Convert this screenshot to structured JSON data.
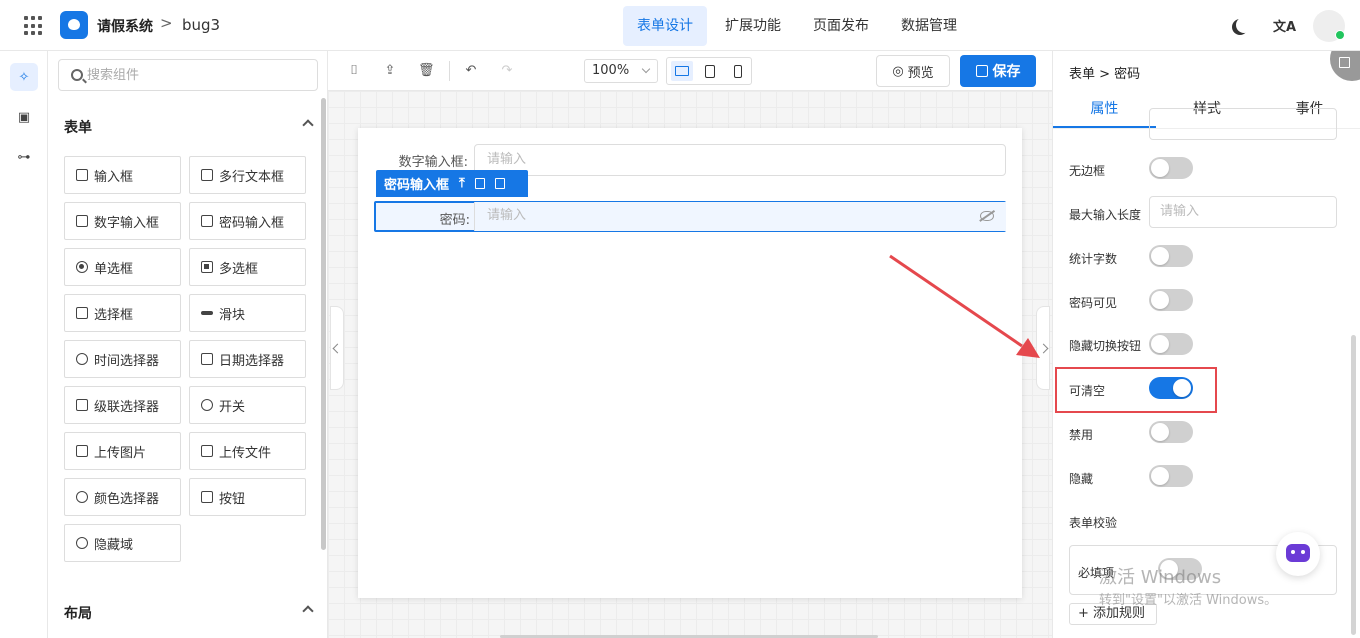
{
  "header": {
    "app_name": "请假系统",
    "crumb_separator": ">",
    "current_app": "bug3",
    "tabs": [
      {
        "label": "表单设计",
        "active": true
      },
      {
        "label": "扩展功能",
        "active": false
      },
      {
        "label": "页面发布",
        "active": false
      },
      {
        "label": "数据管理",
        "active": false
      }
    ],
    "icons": [
      "apps-grid-icon",
      "moon-icon",
      "translate-icon",
      "avatar"
    ]
  },
  "component_panel": {
    "search_placeholder": "搜索组件",
    "section_form": "表单",
    "components": [
      {
        "label": "输入框",
        "icon": "edit-icon"
      },
      {
        "label": "多行文本框",
        "icon": "textarea-icon"
      },
      {
        "label": "数字输入框",
        "icon": "number-icon"
      },
      {
        "label": "密码输入框",
        "icon": "lock-icon"
      },
      {
        "label": "单选框",
        "icon": "radio-icon"
      },
      {
        "label": "多选框",
        "icon": "checkbox-icon"
      },
      {
        "label": "选择框",
        "icon": "select-icon"
      },
      {
        "label": "滑块",
        "icon": "slider-icon"
      },
      {
        "label": "时间选择器",
        "icon": "clock-icon"
      },
      {
        "label": "日期选择器",
        "icon": "calendar-icon"
      },
      {
        "label": "级联选择器",
        "icon": "cascader-icon"
      },
      {
        "label": "开关",
        "icon": "switch-icon"
      },
      {
        "label": "上传图片",
        "icon": "image-icon"
      },
      {
        "label": "上传文件",
        "icon": "upload-icon"
      },
      {
        "label": "颜色选择器",
        "icon": "palette-icon"
      },
      {
        "label": "按钮",
        "icon": "button-icon"
      },
      {
        "label": "隐藏域",
        "icon": "eye-off-icon"
      }
    ],
    "section_layout": "布局"
  },
  "toolbar": {
    "zoom": "100%",
    "preview_label": "预览",
    "save_label": "保存"
  },
  "canvas": {
    "fields": [
      {
        "label": "数字输入框:",
        "placeholder": "请输入"
      },
      {
        "label": "密码:",
        "placeholder": "请输入"
      }
    ],
    "selected_component_label": "密码输入框"
  },
  "props_panel": {
    "breadcrumb": "表单 > 密码",
    "tabs": [
      {
        "label": "属性",
        "active": true
      },
      {
        "label": "样式",
        "active": false
      },
      {
        "label": "事件",
        "active": false
      }
    ],
    "rows": {
      "borderless": {
        "label": "无边框",
        "on": false
      },
      "max_length": {
        "label": "最大输入长度",
        "placeholder": "请输入"
      },
      "word_count": {
        "label": "统计字数",
        "on": false
      },
      "password_visible": {
        "label": "密码可见",
        "on": false
      },
      "hide_toggle_button": {
        "label": "隐藏切换按钮",
        "on": false
      },
      "clearable": {
        "label": "可清空",
        "on": true
      },
      "disabled": {
        "label": "禁用",
        "on": false
      },
      "hidden": {
        "label": "隐藏",
        "on": false
      }
    },
    "validation_title": "表单校验",
    "required_label": "必填项",
    "required_on": false,
    "add_rule_label": "+ 添加规则"
  },
  "watermark": {
    "line1": "激活 Windows",
    "line2": "转到\"设置\"以激活 Windows。"
  },
  "annotation_color": "#e5484d",
  "accent_color": "#1677e5"
}
